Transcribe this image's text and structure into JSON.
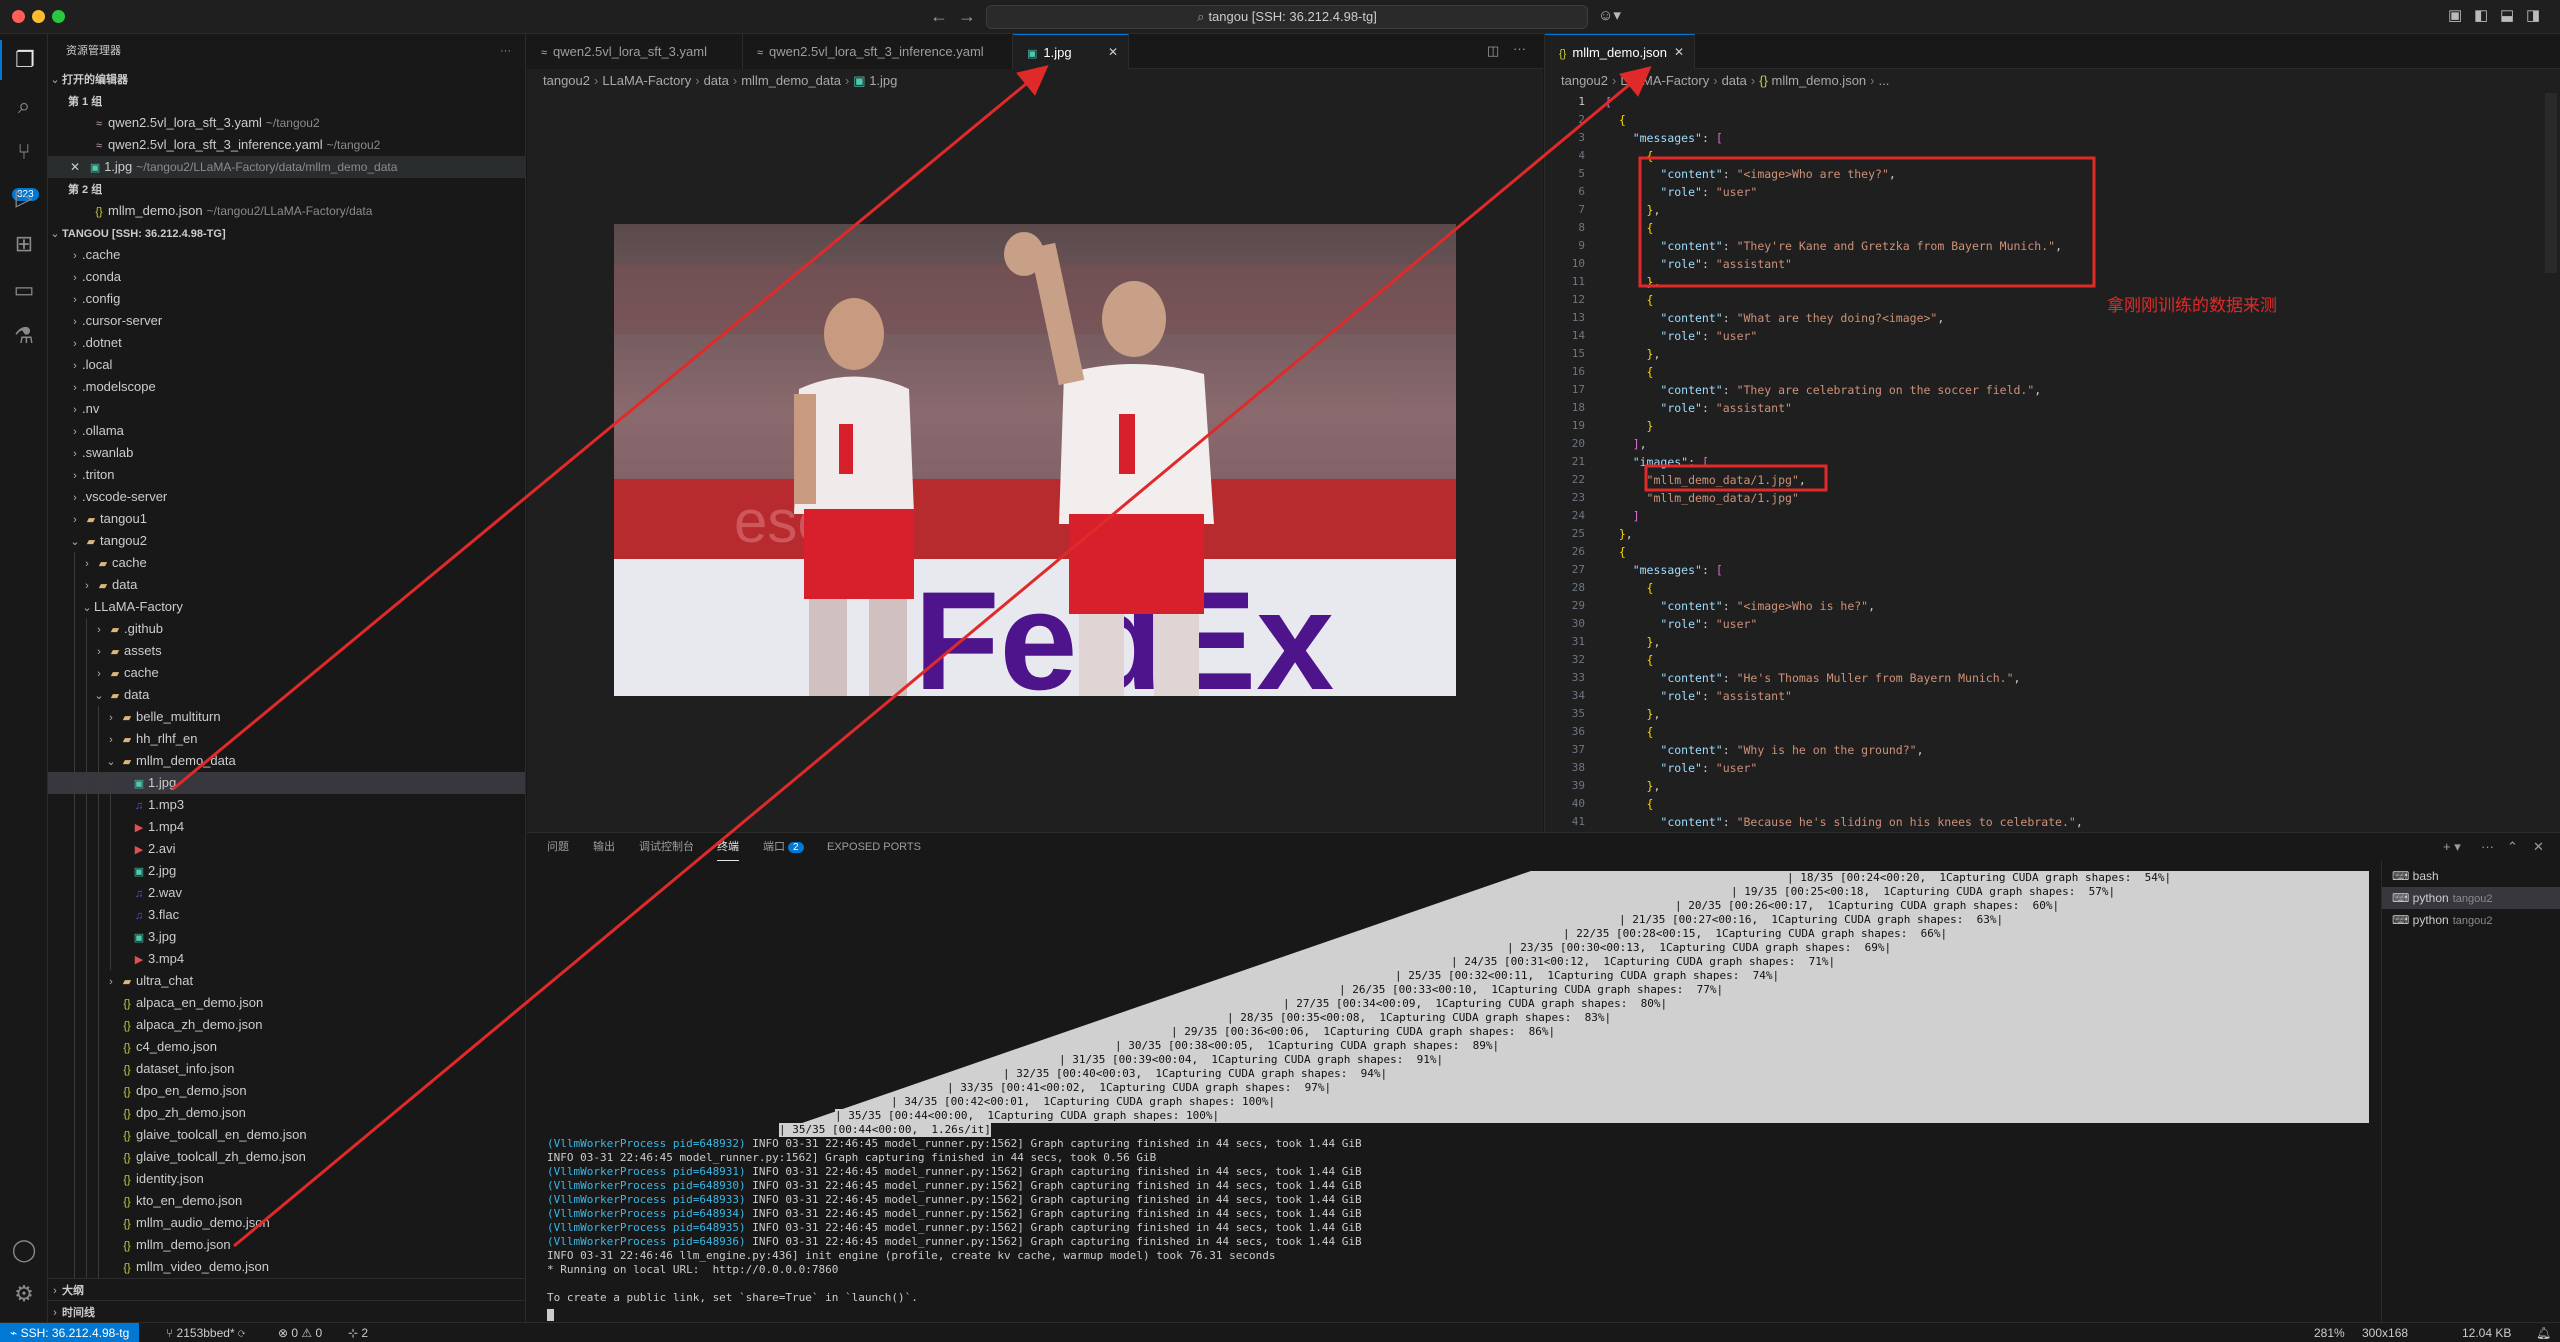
{
  "titlebar": {
    "search": "tangou [SSH: 36.212.4.98-tg]",
    "back_icon": "arrow-left-icon",
    "forward_icon": "arrow-right-icon"
  },
  "activity": {
    "scm_badge": "323"
  },
  "sidebar": {
    "title": "资源管理器",
    "open_editors": {
      "title": "打开的编辑器",
      "group1": "第 1 组",
      "group2": "第 2 组",
      "items": [
        {
          "name": "qwen2.5vl_lora_sft_3.yaml",
          "desc": "~/tangou2"
        },
        {
          "name": "qwen2.5vl_lora_sft_3_inference.yaml",
          "desc": "~/tangou2"
        },
        {
          "name": "1.jpg",
          "desc": "~/tangou2/LLaMA-Factory/data/mllm_demo_data"
        },
        {
          "name": "mllm_demo.json",
          "desc": "~/tangou2/LLaMA-Factory/data"
        }
      ]
    },
    "workspace": "TANGOU [SSH: 36.212.4.98-TG]",
    "tree": [
      ".cache",
      ".conda",
      ".config",
      ".cursor-server",
      ".dotnet",
      ".local",
      ".modelscope",
      ".nv",
      ".ollama",
      ".swanlab",
      ".triton",
      ".vscode-server",
      "tangou1",
      "tangou2",
      "cache",
      "data",
      "LLaMA-Factory",
      ".github",
      "assets",
      "cache",
      "data",
      "belle_multiturn",
      "hh_rlhf_en",
      "mllm_demo_data",
      "1.jpg",
      "1.mp3",
      "1.mp4",
      "2.avi",
      "2.jpg",
      "2.wav",
      "3.flac",
      "3.jpg",
      "3.mp4",
      "ultra_chat",
      "alpaca_en_demo.json",
      "alpaca_zh_demo.json",
      "c4_demo.json",
      "dataset_info.json",
      "dpo_en_demo.json",
      "dpo_zh_demo.json",
      "glaive_toolcall_en_demo.json",
      "glaive_toolcall_zh_demo.json",
      "identity.json",
      "kto_en_demo.json",
      "mllm_audio_demo.json",
      "mllm_demo.json",
      "mllm_video_demo.json"
    ],
    "outline": "大纲",
    "timeline": "时间线"
  },
  "editor1": {
    "tabs": [
      "qwen2.5vl_lora_sft_3.yaml",
      "qwen2.5vl_lora_sft_3_inference.yaml",
      "1.jpg"
    ],
    "breadcrumb": [
      "tangou2",
      "LLaMA-Factory",
      "data",
      "mllm_demo_data",
      "1.jpg"
    ],
    "photo_text": "FedEx"
  },
  "editor2": {
    "tab": "mllm_demo.json",
    "breadcrumb": [
      "tangou2",
      "LLaMA-Factory",
      "data",
      "mllm_demo.json",
      "..."
    ],
    "lines": [
      "[",
      "  {",
      "    \"messages\": [",
      "      {",
      "        \"content\": \"<image>Who are they?\",",
      "        \"role\": \"user\"",
      "      },",
      "      {",
      "        \"content\": \"They're Kane and Gretzka from Bayern Munich.\",",
      "        \"role\": \"assistant\"",
      "      },",
      "      {",
      "        \"content\": \"What are they doing?<image>\",",
      "        \"role\": \"user\"",
      "      },",
      "      {",
      "        \"content\": \"They are celebrating on the soccer field.\",",
      "        \"role\": \"assistant\"",
      "      }",
      "    ],",
      "    \"images\": [",
      "      \"mllm_demo_data/1.jpg\",",
      "      \"mllm_demo_data/1.jpg\"",
      "    ]",
      "  },",
      "  {",
      "    \"messages\": [",
      "      {",
      "        \"content\": \"<image>Who is he?\",",
      "        \"role\": \"user\"",
      "      },",
      "      {",
      "        \"content\": \"He's Thomas Muller from Bayern Munich.\",",
      "        \"role\": \"assistant\"",
      "      },",
      "      {",
      "        \"content\": \"Why is he on the ground?\",",
      "        \"role\": \"user\"",
      "      },",
      "      {",
      "        \"content\": \"Because he's sliding on his knees to celebrate.\","
    ],
    "annotation": "拿刚刚训练的数据来测"
  },
  "panel": {
    "tabs": [
      "问题",
      "输出",
      "调试控制台",
      "终端",
      "端口",
      "EXPOSED PORTS"
    ],
    "ports_badge": "2",
    "progress": [
      "| 18/35 [00:24<00:20,  1Capturing CUDA graph shapes:  54%|",
      "| 19/35 [00:25<00:18,  1Capturing CUDA graph shapes:  57%|",
      "| 20/35 [00:26<00:17,  1Capturing CUDA graph shapes:  60%|",
      "| 21/35 [00:27<00:16,  1Capturing CUDA graph shapes:  63%|",
      "| 22/35 [00:28<00:15,  1Capturing CUDA graph shapes:  66%|",
      "| 23/35 [00:30<00:13,  1Capturing CUDA graph shapes:  69%|",
      "| 24/35 [00:31<00:12,  1Capturing CUDA graph shapes:  71%|",
      "| 25/35 [00:32<00:11,  1Capturing CUDA graph shapes:  74%|",
      "| 26/35 [00:33<00:10,  1Capturing CUDA graph shapes:  77%|",
      "| 27/35 [00:34<00:09,  1Capturing CUDA graph shapes:  80%|",
      "| 28/35 [00:35<00:08,  1Capturing CUDA graph shapes:  83%|",
      "| 29/35 [00:36<00:06,  1Capturing CUDA graph shapes:  86%|",
      "| 30/35 [00:38<00:05,  1Capturing CUDA graph shapes:  89%|",
      "| 31/35 [00:39<00:04,  1Capturing CUDA graph shapes:  91%|",
      "| 32/35 [00:40<00:03,  1Capturing CUDA graph shapes:  94%|",
      "| 33/35 [00:41<00:02,  1Capturing CUDA graph shapes:  97%|",
      "| 34/35 [00:42<00:01,  1Capturing CUDA graph shapes: 100%|",
      "| 35/35 [00:44<00:00,  1Capturing CUDA graph shapes: 100%|",
      "| 35/35 [00:44<00:00,  1.26s/it]"
    ],
    "log": [
      {
        "tag": "(VllmWorkerProcess pid=648932)",
        "text": " INFO 03-31 22:46:45 model_runner.py:1562] Graph capturing finished in 44 secs, took 1.44 GiB"
      },
      {
        "tag": "",
        "text": "INFO 03-31 22:46:45 model_runner.py:1562] Graph capturing finished in 44 secs, took 0.56 GiB"
      },
      {
        "tag": "(VllmWorkerProcess pid=648931)",
        "text": " INFO 03-31 22:46:45 model_runner.py:1562] Graph capturing finished in 44 secs, took 1.44 GiB"
      },
      {
        "tag": "(VllmWorkerProcess pid=648930)",
        "text": " INFO 03-31 22:46:45 model_runner.py:1562] Graph capturing finished in 44 secs, took 1.44 GiB"
      },
      {
        "tag": "(VllmWorkerProcess pid=648933)",
        "text": " INFO 03-31 22:46:45 model_runner.py:1562] Graph capturing finished in 44 secs, took 1.44 GiB"
      },
      {
        "tag": "(VllmWorkerProcess pid=648934)",
        "text": " INFO 03-31 22:46:45 model_runner.py:1562] Graph capturing finished in 44 secs, took 1.44 GiB"
      },
      {
        "tag": "(VllmWorkerProcess pid=648935)",
        "text": " INFO 03-31 22:46:45 model_runner.py:1562] Graph capturing finished in 44 secs, took 1.44 GiB"
      },
      {
        "tag": "(VllmWorkerProcess pid=648936)",
        "text": " INFO 03-31 22:46:45 model_runner.py:1562] Graph capturing finished in 44 secs, took 1.44 GiB"
      },
      {
        "tag": "",
        "text": "INFO 03-31 22:46:46 llm_engine.py:436] init engine (profile, create kv cache, warmup model) took 76.31 seconds"
      },
      {
        "tag": "",
        "text": "* Running on local URL:  http://0.0.0.0:7860"
      },
      {
        "tag": "",
        "text": ""
      },
      {
        "tag": "",
        "text": "To create a public link, set `share=True` in `launch()`."
      }
    ],
    "terminals": [
      {
        "name": "bash",
        "desc": ""
      },
      {
        "name": "python",
        "desc": "tangou2"
      },
      {
        "name": "python",
        "desc": "tangou2"
      }
    ]
  },
  "statusbar": {
    "remote": "SSH: 36.212.4.98-tg",
    "branch": "2153bbed*",
    "problems": "0 ⚠ 0",
    "ports": "2",
    "zoom": "281%",
    "dims": "300x168",
    "size": "12.04 KB"
  }
}
